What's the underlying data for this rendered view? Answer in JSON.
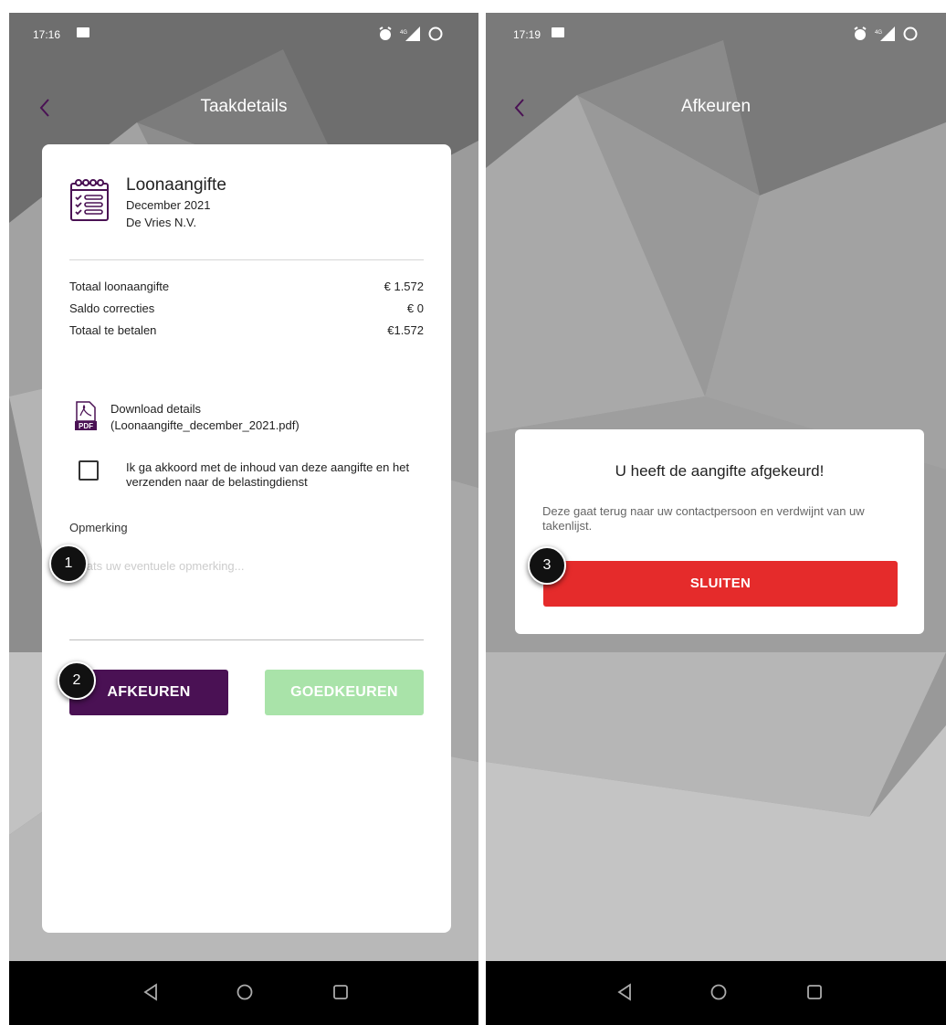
{
  "colors": {
    "brand_purple": "#4a1154",
    "approve_green": "#a9e3a9",
    "close_red": "#e52b2b",
    "badge_black": "#111111"
  },
  "left_screen": {
    "status": {
      "time": "17:16",
      "network": "4G"
    },
    "nav": {
      "title": "Taakdetails",
      "back_icon": "chevron-left-icon"
    },
    "task": {
      "title": "Loonaangifte",
      "month": "December 2021",
      "company": "De Vries N.V.",
      "icon": "calendar-checklist-icon"
    },
    "summary": [
      {
        "label": "Totaal loonaangifte",
        "value": "€ 1.572"
      },
      {
        "label": "Saldo correcties",
        "value": "€ 0"
      },
      {
        "label": "Totaal te betalen",
        "value": "€1.572"
      }
    ],
    "download": {
      "title": "Download details",
      "file": "(Loonaangifte_december_2021.pdf)",
      "icon": "pdf-icon",
      "icon_label": "PDF"
    },
    "agreement": {
      "text": "Ik ga akkoord met de inhoud van deze aangifte en het verzenden naar de belastingdienst",
      "checked": false
    },
    "remark": {
      "label": "Opmerking",
      "placeholder": "Plaats uw eventuele opmerking..."
    },
    "buttons": {
      "reject": "AFKEUREN",
      "approve": "GOEDKEUREN"
    },
    "badges": {
      "one": "1",
      "two": "2"
    }
  },
  "right_screen": {
    "status": {
      "time": "17:19",
      "network": "4G"
    },
    "nav": {
      "title": "Afkeuren",
      "back_icon": "chevron-left-icon"
    },
    "dialog": {
      "title": "U heeft de aangifte afgekeurd!",
      "message": "Deze gaat terug naar uw contactpersoon en verdwijnt van uw takenlijst.",
      "close_button": "SLUITEN"
    },
    "badges": {
      "three": "3"
    }
  },
  "system_nav": {
    "back": "back-triangle-icon",
    "home": "home-circle-icon",
    "recents": "recents-square-icon"
  }
}
